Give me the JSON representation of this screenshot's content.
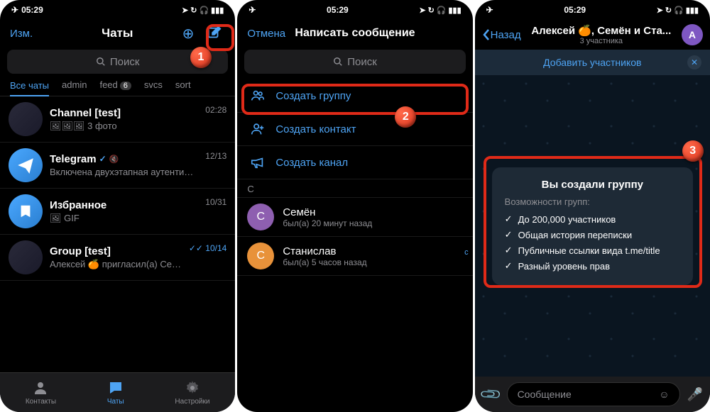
{
  "status": {
    "time": "05:29",
    "airplane": "✈︎",
    "gps": "➤",
    "loop": "↻",
    "headset": "🎧",
    "battery": "▮▮▮"
  },
  "s1": {
    "edit": "Изм.",
    "title": "Чаты",
    "search": "Поиск",
    "tabs": {
      "all": "Все чаты",
      "admin": "admin",
      "feed": "feed",
      "feed_badge": "6",
      "svcs": "svcs",
      "sort": "sort"
    },
    "chats": [
      {
        "name": "Channel [test]",
        "sub": "🖼🖼🖼 3 фото",
        "time": "02:28"
      },
      {
        "name": "Telegram",
        "verified": "✓",
        "mute": "🔇",
        "sub": "Включена двухэтапная аутентификация! Алексей 🍊, двухэта...",
        "time": "12/13"
      },
      {
        "name": "Избранное",
        "sub": "🖼 GIF",
        "time": "10/31"
      },
      {
        "name": "Group [test]",
        "sub": "Алексей 🍊 пригласил(а) Семён",
        "time": "✓✓ 10/14"
      }
    ],
    "nav": {
      "contacts": "Контакты",
      "chats": "Чаты",
      "settings": "Настройки"
    }
  },
  "s2": {
    "cancel": "Отмена",
    "title": "Написать сообщение",
    "search": "Поиск",
    "group": "Создать группу",
    "contact": "Создать контакт",
    "channel": "Создать канал",
    "section": "С",
    "contacts": [
      {
        "initial": "С",
        "name": "Семён",
        "sub": "был(а) 20 минут назад",
        "color": "#8e5fb0"
      },
      {
        "initial": "С",
        "name": "Станислав",
        "sub": "был(а) 5 часов назад",
        "color": "#e8923a"
      }
    ],
    "index": "с"
  },
  "s3": {
    "back": "Назад",
    "title": "Алексей 🍊, Семён и Ста...",
    "members": "3 участника",
    "add": "Добавить участников",
    "avatar": "А",
    "card": {
      "title": "Вы создали группу",
      "sub": "Возможности групп:",
      "items": [
        "До 200,000 участников",
        "Общая история переписки",
        "Публичные ссылки вида t.me/title",
        "Разный уровень прав"
      ]
    },
    "input": "Сообщение"
  },
  "callouts": {
    "c1": "1",
    "c2": "2",
    "c3": "3"
  }
}
